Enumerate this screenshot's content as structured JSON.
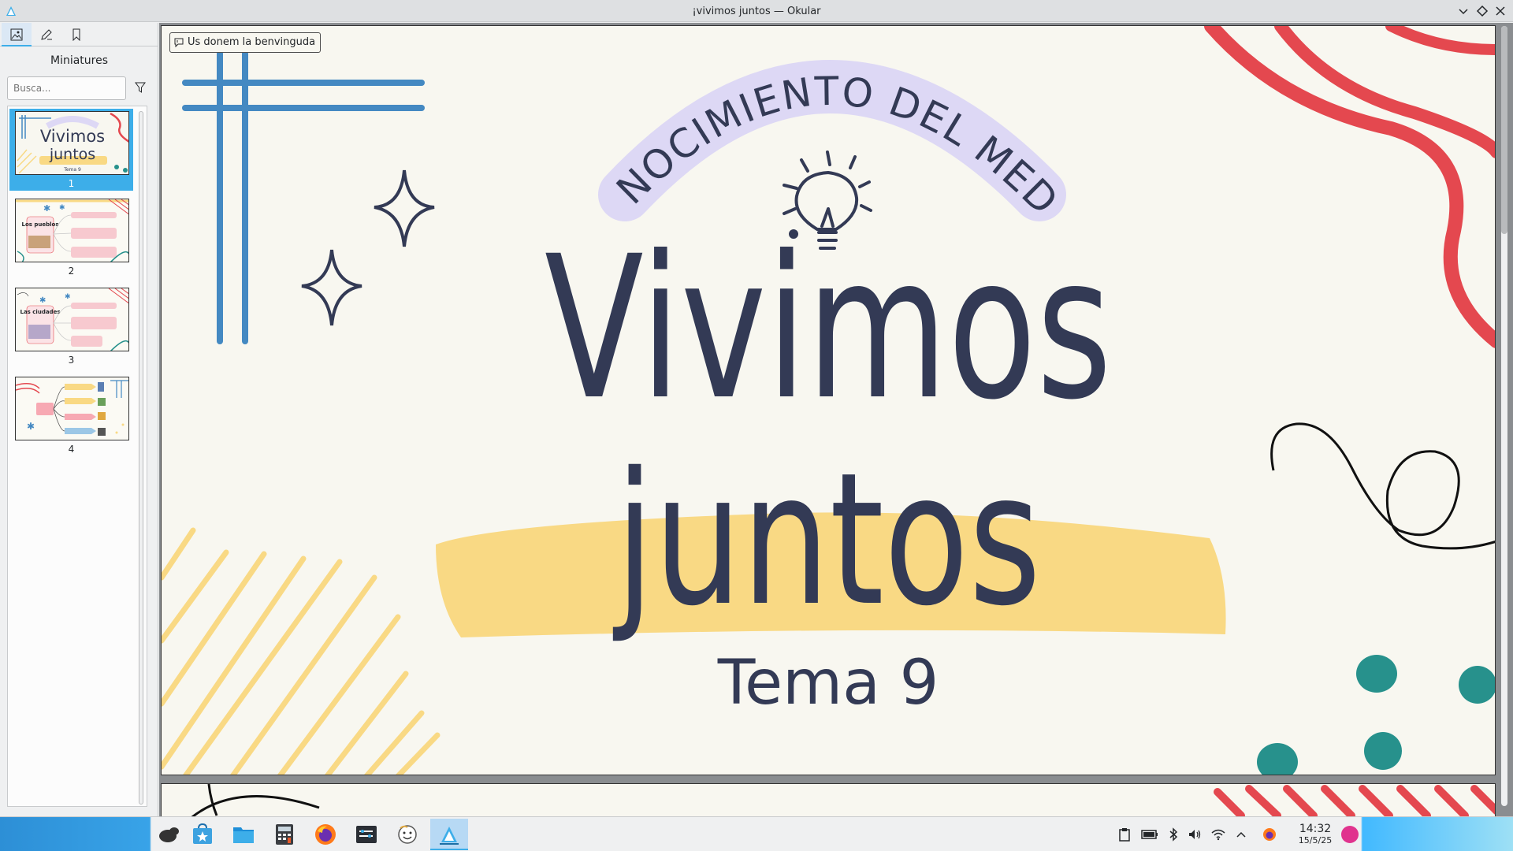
{
  "window": {
    "title": "¡vivimos juntos — Okular",
    "controls": [
      "minimize",
      "maximize",
      "close"
    ]
  },
  "sidebar": {
    "tabs": [
      {
        "name": "thumbnails",
        "icon": "image-icon",
        "active": true
      },
      {
        "name": "annotations",
        "icon": "pen-icon",
        "active": false
      },
      {
        "name": "bookmarks",
        "icon": "bookmark-icon",
        "active": false
      }
    ],
    "heading": "Miniatures",
    "search_placeholder": "Busca...",
    "thumbnails": [
      {
        "page": "1",
        "selected": true
      },
      {
        "page": "2",
        "selected": false
      },
      {
        "page": "3",
        "selected": false
      },
      {
        "page": "4",
        "selected": false
      }
    ],
    "thumb_texts": {
      "t1_line1": "Vivimos",
      "t1_line2": "juntos",
      "t1_line3": "Tema 9",
      "t2_label": "Los pueblos",
      "t3_label": "Las ciudades"
    }
  },
  "viewer": {
    "welcome_message": "Us donem la benvinguda",
    "slide": {
      "arc_text": "CONOCIMIENTO DEL MEDIO",
      "title_line1": "Vivimos",
      "title_line2": "juntos",
      "subtitle": "Tema 9"
    }
  },
  "taskbar": {
    "apps": [
      "plasma-launcher-icon",
      "discover-icon",
      "file-manager-icon",
      "calculator-icon",
      "firefox-icon",
      "terminal-icon",
      "face-app-icon",
      "okular-icon"
    ],
    "active_app": "okular-icon",
    "clock_time": "14:32",
    "clock_date": "15/5/25"
  },
  "colors": {
    "accent": "#3daee9",
    "slide_bg": "#f8f7f0",
    "navy": "#333a55",
    "lavender": "#ddd8f5",
    "yellow": "#f9d984",
    "red": "#e4484f",
    "teal": "#27918c",
    "blue": "#4489c2"
  }
}
